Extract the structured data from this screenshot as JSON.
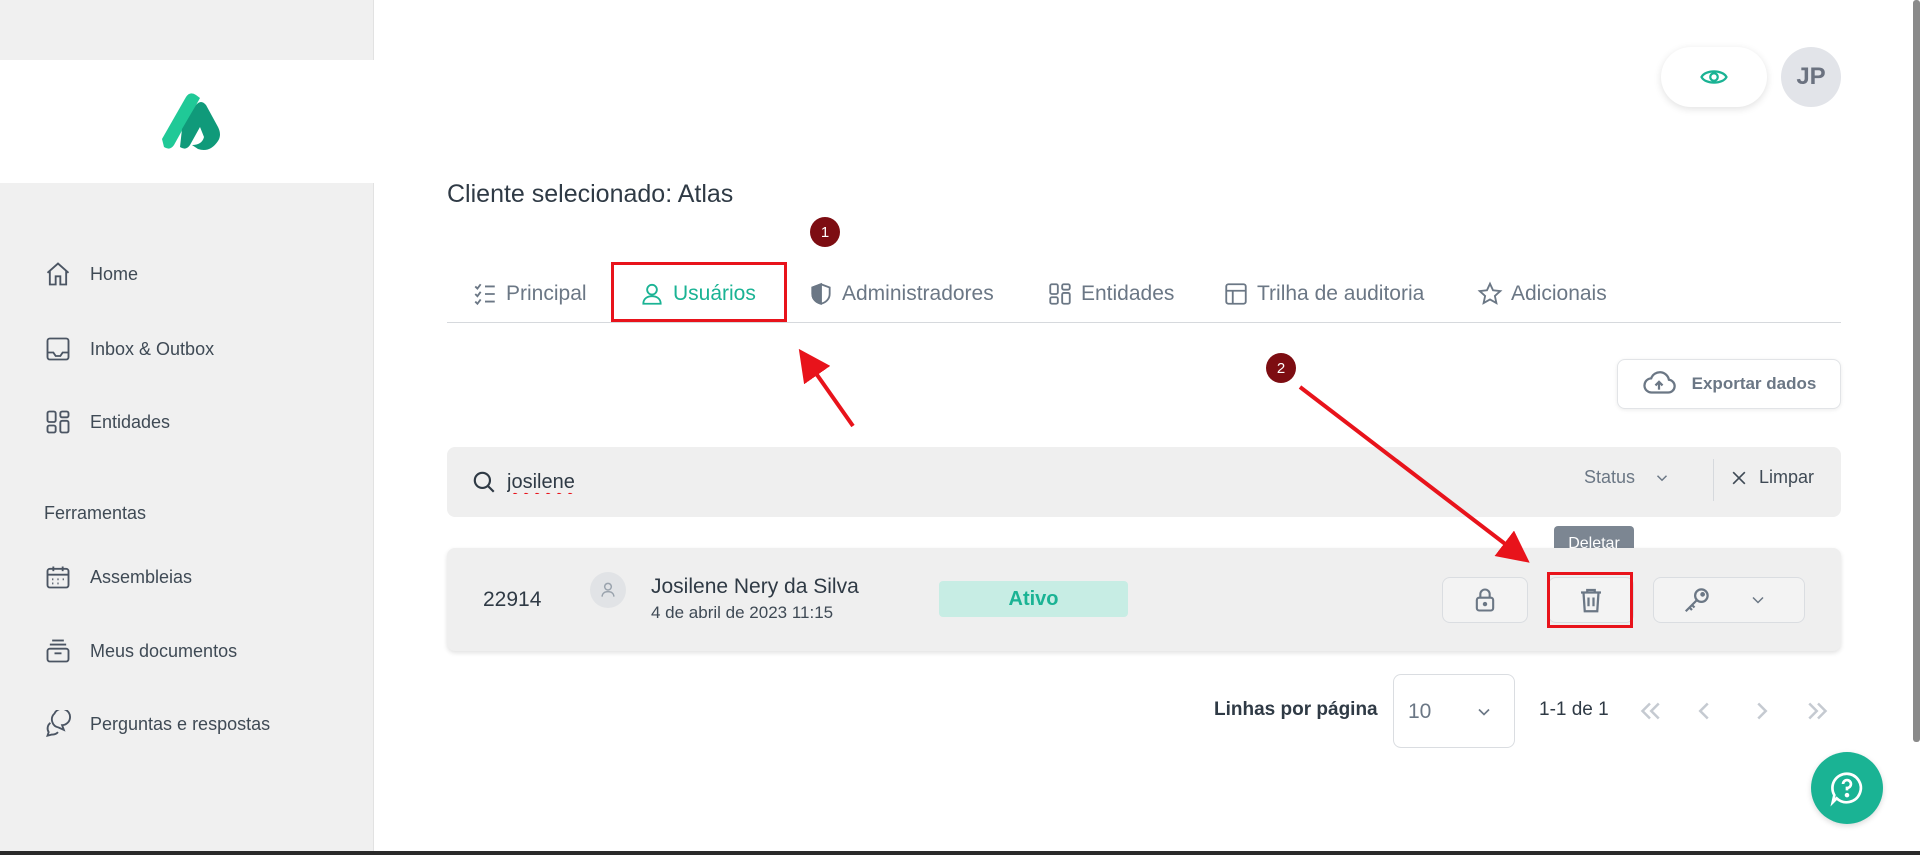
{
  "sidebar": {
    "items": [
      {
        "label": "Home"
      },
      {
        "label": "Inbox & Outbox"
      },
      {
        "label": "Entidades"
      }
    ],
    "section_title": "Ferramentas",
    "tools": [
      {
        "label": "Assembleias"
      },
      {
        "label": "Meus documentos"
      },
      {
        "label": "Perguntas e respostas"
      }
    ]
  },
  "header": {
    "avatar_initials": "JP"
  },
  "page": {
    "title": "Cliente selecionado: Atlas"
  },
  "tabs": [
    {
      "label": "Principal"
    },
    {
      "label": "Usuários"
    },
    {
      "label": "Administradores"
    },
    {
      "label": "Entidades"
    },
    {
      "label": "Trilha de auditoria"
    },
    {
      "label": "Adicionais"
    }
  ],
  "annotations": {
    "badge_1": "1",
    "badge_2": "2"
  },
  "toolbar": {
    "export_label": "Exportar dados"
  },
  "filters": {
    "search_value": "josilene",
    "status_label": "Status",
    "clear_label": "Limpar"
  },
  "tooltip": {
    "delete": "Deletar"
  },
  "user": {
    "id": "22914",
    "name": "Josilene Nery da Silva",
    "date": "4 de abril de 2023 11:15",
    "status": "Ativo"
  },
  "pagination": {
    "rows_label": "Linhas por página",
    "rows_value": "10",
    "range": "1-1 de 1"
  },
  "colors": {
    "accent": "#1ab394",
    "annotation_red": "#e8131b",
    "badge_bg": "#7d0d12"
  }
}
